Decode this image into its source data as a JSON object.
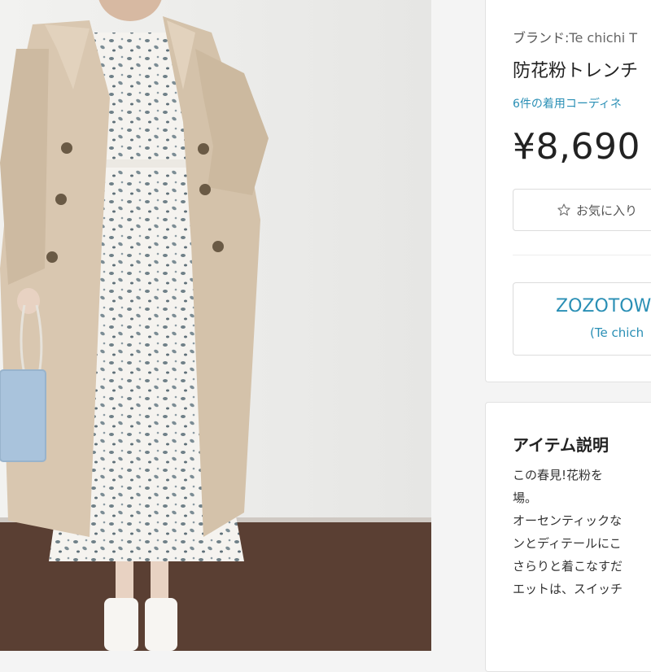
{
  "product": {
    "brand_label": "ブランド:",
    "brand_name": "Te chichi T",
    "title": "防花粉トレンチ",
    "coordinate_link": "6件の着用コーディネ",
    "price": "¥8,690",
    "favorite_button": "お気に入り",
    "store_button_main": "ZOZOTOW",
    "store_button_sub": "(Te chich"
  },
  "description": {
    "heading": "アイテム説明",
    "lines": [
      "この春見!花粉を",
      "場。",
      "オーセンティックな",
      "ンとディテールにこ",
      "さらりと着こなすだ",
      "エットは、スイッチ"
    ]
  },
  "icons": {
    "favorite": "star-outline-icon"
  },
  "colors": {
    "accent": "#2a8fb5",
    "coat": "#d9c7b0",
    "dress": "#f4f2ee",
    "bag": "#a9c3dc",
    "floor": "#5a3f33"
  }
}
